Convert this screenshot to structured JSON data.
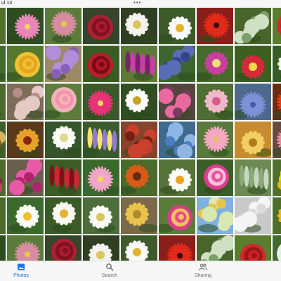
{
  "status_bar": {
    "time": "ul 13",
    "dots": "•••"
  },
  "photos": [
    {
      "bg": "#4f6f2a",
      "petal": "#f2b90f",
      "center": "#5a3312",
      "kind": "daisy"
    },
    {
      "bg": "#2d4d1f",
      "petal": "#e887b8",
      "center": "#f0d16a",
      "kind": "spiky"
    },
    {
      "bg": "#5b7b3a",
      "petal": "#d88ca0",
      "center": "#e8c64a",
      "kind": "spiky"
    },
    {
      "bg": "#36452b",
      "petal": "#b31f34",
      "center": "#7a0f1e",
      "kind": "rose"
    },
    {
      "bg": "#2e3f22",
      "petal": "#f4f3ee",
      "center": "#d9c65e",
      "kind": "daisy"
    },
    {
      "bg": "#3d5a2a",
      "petal": "#fafafa",
      "center": "#e4b52a",
      "kind": "daisy"
    },
    {
      "bg": "#8a1f1a",
      "petal": "#e02a1a",
      "center": "#3a0c08",
      "kind": "spiky"
    },
    {
      "bg": "#49652c",
      "petal": "#cfe0c5",
      "center": "#7aa06a",
      "kind": "round"
    },
    {
      "bg": "#5a7d2e",
      "petal": "#d8252a",
      "center": "#901418",
      "kind": "rose"
    },
    {
      "bg": "#406c2f",
      "petal": "#f5f5f3",
      "center": "#e0d7a0",
      "kind": "rose"
    },
    {
      "bg": "#557a2f",
      "petal": "#f5c638",
      "center": "#e29f1c",
      "kind": "rose"
    },
    {
      "bg": "#9c8a66",
      "petal": "#b08fd8",
      "center": "#8a5fb8",
      "kind": "round"
    },
    {
      "bg": "#3a5d24",
      "petal": "#c3192b",
      "center": "#6d0b16",
      "kind": "rose"
    },
    {
      "bg": "#5e7a37",
      "petal": "#c93ea8",
      "center": "#7b1f6e",
      "kind": "spike"
    },
    {
      "bg": "#3c6630",
      "petal": "#5a6bb8",
      "center": "#36458a",
      "kind": "round"
    },
    {
      "bg": "#48692c",
      "petal": "#c93e9e",
      "center": "#f0e17a",
      "kind": "daisy"
    },
    {
      "bg": "#3d5f22",
      "petal": "#d52a3a",
      "center": "#ffd84a",
      "kind": "daisy"
    },
    {
      "bg": "#345d27",
      "petal": "#f7f5ef",
      "center": "#d9c65e",
      "kind": "daisy"
    },
    {
      "bg": "#4c6a2c",
      "petal": "#e55aa6",
      "center": "#f0d16a",
      "kind": "spiky"
    },
    {
      "bg": "#7d6d58",
      "petal": "#e5c9c3",
      "center": "#b88c8a",
      "kind": "round"
    },
    {
      "bg": "#5c7d3c",
      "petal": "#f6b7c2",
      "center": "#f38ea4",
      "kind": "rose"
    },
    {
      "bg": "#3a5a2b",
      "petal": "#e83377",
      "center": "#f3d75c",
      "kind": "spiky"
    },
    {
      "bg": "#2f4f22",
      "petal": "#fbfbf8",
      "center": "#c9a227",
      "kind": "daisy"
    },
    {
      "bg": "#54463d",
      "petal": "#e86aa0",
      "center": "#7a3a60",
      "kind": "round"
    },
    {
      "bg": "#4e6e34",
      "petal": "#efb7c8",
      "center": "#d75b8a",
      "kind": "daisy"
    },
    {
      "bg": "#4d6a8d",
      "petal": "#7d90d8",
      "center": "#445ba8",
      "kind": "spiky"
    },
    {
      "bg": "#6d2b14",
      "petal": "#ee3a12",
      "center": "#f2b020",
      "kind": "spiky"
    },
    {
      "bg": "#3f5e28",
      "petal": "#d4b45a",
      "center": "#8c5a2a",
      "kind": "round"
    },
    {
      "bg": "#5a3a1a",
      "petal": "#e7a22a",
      "center": "#8a2416",
      "kind": "daisy"
    },
    {
      "bg": "#35552a",
      "petal": "#fbfbf6",
      "center": "#e2d88f",
      "kind": "daisy"
    },
    {
      "bg": "#3b5a2d",
      "petal": "#8e7bd0",
      "center": "#f5e36a",
      "kind": "spike"
    },
    {
      "bg": "#86442c",
      "petal": "#c9402c",
      "center": "#7a1f14",
      "kind": "round"
    },
    {
      "bg": "#3d6a8d",
      "petal": "#8fb6e2",
      "center": "#4b7ec0",
      "kind": "round"
    },
    {
      "bg": "#5a7a3d",
      "petal": "#f5a7c3",
      "center": "#d9c65e",
      "kind": "spiky"
    },
    {
      "bg": "#c98b2f",
      "petal": "#f1cf63",
      "center": "#b47a1c",
      "kind": "daisy"
    },
    {
      "bg": "#6b4a3e",
      "petal": "#f08ba6",
      "center": "#cf4c72",
      "kind": "spiky"
    },
    {
      "bg": "#4b6a2c",
      "petal": "#c9406a",
      "center": "#8a2040",
      "kind": "round"
    },
    {
      "bg": "#6a5e4c",
      "petal": "#e85aa5",
      "center": "#b0246e",
      "kind": "round"
    },
    {
      "bg": "#3a5e25",
      "petal": "#cf2632",
      "center": "#7f0f18",
      "kind": "spike"
    },
    {
      "bg": "#3a6a2a",
      "petal": "#f0a6c6",
      "center": "#f3d75c",
      "kind": "spiky"
    },
    {
      "bg": "#4a6a2a",
      "petal": "#d85a18",
      "center": "#6a2a10",
      "kind": "daisy"
    },
    {
      "bg": "#56733a",
      "petal": "#fbfbf8",
      "center": "#f0a020",
      "kind": "daisy"
    },
    {
      "bg": "#3b5e28",
      "petal": "#e63b92",
      "center": "#f7d8e6",
      "kind": "rose"
    },
    {
      "bg": "#6c8a52",
      "petal": "#c8d8c0",
      "center": "#8aa87a",
      "kind": "spike"
    },
    {
      "bg": "#51702d",
      "petal": "#f2d21a",
      "center": "#e6b510",
      "kind": "round"
    },
    {
      "bg": "#4a6a2e",
      "petal": "#ed7b93",
      "center": "#c8405a",
      "kind": "rose"
    },
    {
      "bg": "#3b6a2d",
      "petal": "#fbfbf8",
      "center": "#f2c12a",
      "kind": "daisy"
    },
    {
      "bg": "#3a5a28",
      "petal": "#f9f7f0",
      "center": "#e4b52a",
      "kind": "daisy"
    },
    {
      "bg": "#4d6e3a",
      "petal": "#fbfbf8",
      "center": "#d9c65e",
      "kind": "daisy"
    },
    {
      "bg": "#7a6a4a",
      "petal": "#e8c24a",
      "center": "#b08a2a",
      "kind": "daisy"
    },
    {
      "bg": "#5b7b3a",
      "petal": "#e03a8a",
      "center": "#f3d75c",
      "kind": "rose"
    },
    {
      "bg": "#7fb0e0",
      "petal": "#d8e8b0",
      "center": "#e6c64a",
      "kind": "round"
    },
    {
      "bg": "#c9c9c9",
      "petal": "#f5f5f5",
      "center": "#dcdcdc",
      "kind": "round"
    }
  ],
  "tabs": [
    {
      "label": "Photos",
      "icon": "photos-icon",
      "active": true
    },
    {
      "label": "Search",
      "icon": "search-icon",
      "active": false
    },
    {
      "label": "Sharing",
      "icon": "people-icon",
      "active": false
    }
  ],
  "colors": {
    "accent": "#1a73e8",
    "inactive": "#6e6e6e"
  }
}
